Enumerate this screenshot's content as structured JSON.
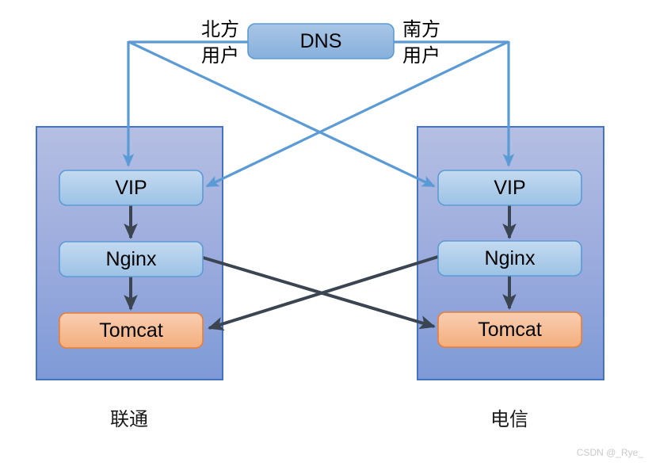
{
  "diagram": {
    "title": "DNS",
    "nodes": {
      "dns": "DNS",
      "left_vip": "VIP",
      "left_nginx": "Nginx",
      "left_tomcat": "Tomcat",
      "right_vip": "VIP",
      "right_nginx": "Nginx",
      "right_tomcat": "Tomcat"
    },
    "user_labels": {
      "north_line1": "北方",
      "north_line2": "用户",
      "south_line1": "南方",
      "south_line2": "用户"
    },
    "datacenter_labels": {
      "left": "联通",
      "right": "电信"
    },
    "colors": {
      "dns_fill_top": "#a8c4e3",
      "dns_fill_bottom": "#8db3dd",
      "dns_border": "#5b9bd5",
      "node_blue_fill_top": "#bdd7ee",
      "node_blue_fill_bottom": "#9dc3e6",
      "node_blue_border": "#5b9bd5",
      "tomcat_fill_top": "#f8cbad",
      "tomcat_fill_bottom": "#f4b183",
      "tomcat_border": "#ed7d31",
      "container_fill_top": "#b4bee2",
      "container_fill_bottom": "#7f9bd8",
      "container_border": "#4472c4",
      "blue_arrow": "#5b9bd5",
      "dark_arrow": "#3b4451",
      "background": "#ffffff"
    }
  },
  "watermark": {
    "text": "CSDN @_Rye_"
  }
}
